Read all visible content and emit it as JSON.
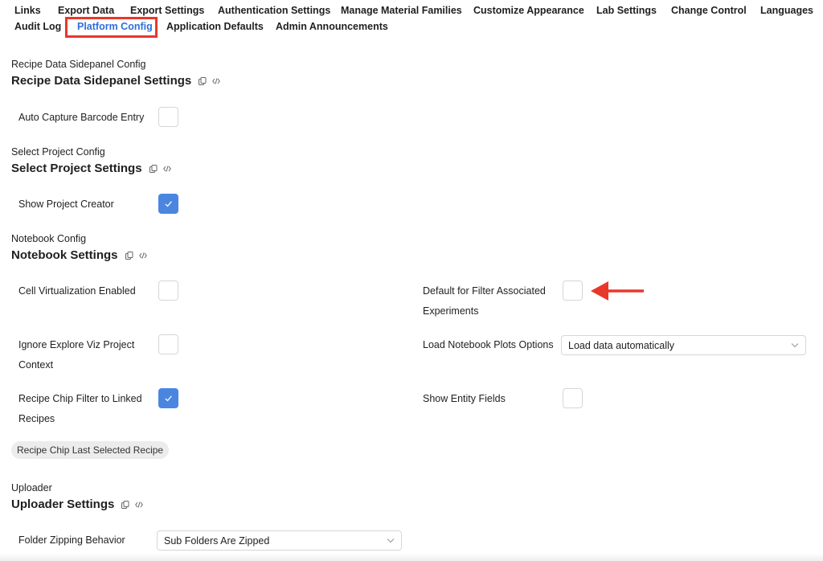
{
  "nav": {
    "items": [
      "Links",
      "Export Data",
      "Export Settings",
      "Authentication Settings",
      "Manage Material Families",
      "Customize Appearance",
      "Lab Settings",
      "Change Control",
      "Languages",
      "Audit Log",
      "Platform Config",
      "Application Defaults",
      "Admin Announcements"
    ],
    "active": "Platform Config",
    "active_color": "#2f6fd8",
    "highlight_color": "#e8382a"
  },
  "recipe_sidepanel": {
    "config_label": "Recipe Data Sidepanel Config",
    "title": "Recipe Data Sidepanel Settings",
    "auto_capture": {
      "label": "Auto Capture Barcode Entry",
      "checked": false
    }
  },
  "select_project": {
    "config_label": "Select Project Config",
    "title": "Select Project Settings",
    "show_creator": {
      "label": "Show Project Creator",
      "checked": true
    }
  },
  "notebook": {
    "config_label": "Notebook Config",
    "title": "Notebook Settings",
    "cell_virtualization": {
      "label": "Cell Virtualization Enabled",
      "checked": false
    },
    "default_filter": {
      "label": "Default for Filter Associated Experiments",
      "checked": false
    },
    "ignore_explore": {
      "label": "Ignore Explore Viz Project Context",
      "checked": false
    },
    "load_plots": {
      "label": "Load Notebook Plots Options",
      "value": "Load data automatically"
    },
    "recipe_chip_filter": {
      "label": "Recipe Chip Filter to Linked Recipes",
      "checked": true
    },
    "show_entity": {
      "label": "Show Entity Fields",
      "checked": false
    },
    "chip_label": "Recipe Chip Last Selected Recipe"
  },
  "uploader": {
    "config_label": "Uploader",
    "title": "Uploader Settings",
    "folder_zipping": {
      "label": "Folder Zipping Behavior",
      "value": "Sub Folders Are Zipped"
    }
  },
  "icons": {
    "copy": "copy-icon",
    "code": "code-icon",
    "check": "check-icon",
    "chevron": "chevron-down-icon",
    "annotation": "arrow-left-icon"
  },
  "colors": {
    "checkbox_checked": "#4a86e0",
    "annotation_arrow": "#e8382a"
  }
}
